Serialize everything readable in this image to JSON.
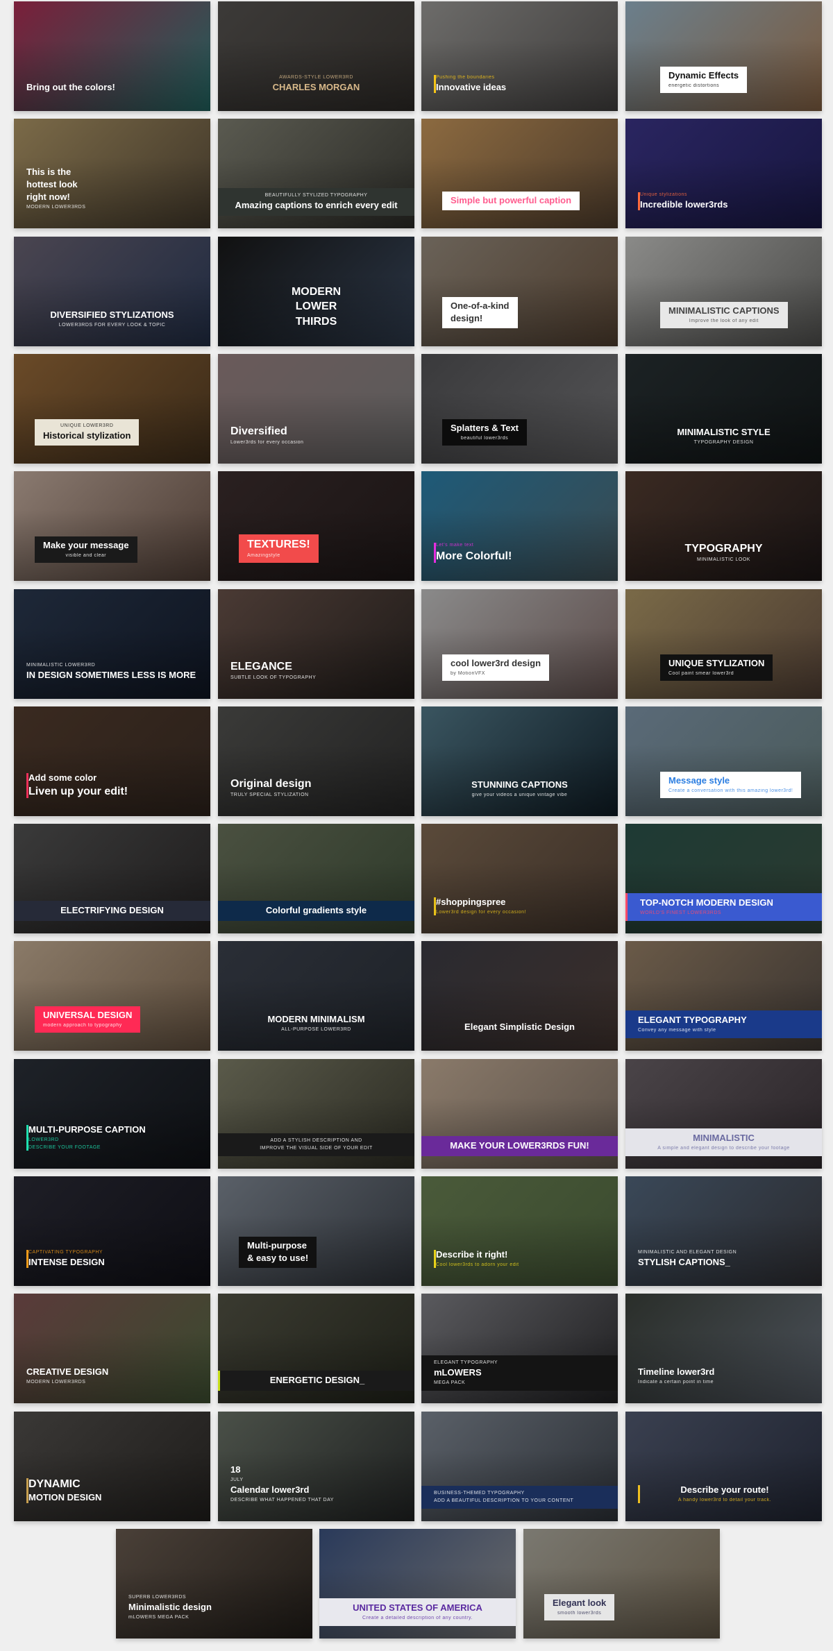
{
  "tiles": [
    {
      "bg": [
        "#7a1f3a",
        "#1f5e5a"
      ],
      "lines": [
        {
          "t": "Bring out the colors!",
          "k": "h"
        }
      ]
    },
    {
      "bg": [
        "#3c3a38",
        "#2a2724"
      ],
      "fg": "#d8b98a",
      "lines": [
        {
          "t": "AWARDS-STYLE LOWER3RD",
          "k": "s"
        },
        {
          "t": "CHARLES MORGAN",
          "k": "h"
        }
      ]
    },
    {
      "bg": [
        "#6d6c6a",
        "#3d3b3a"
      ],
      "accent": "#f5c518",
      "lines": [
        {
          "t": "Pushing the boundaries",
          "k": "s"
        },
        {
          "t": "Innovative ideas",
          "k": "h"
        }
      ]
    },
    {
      "bg": [
        "#6b7f8c",
        "#7a5a3e"
      ],
      "box": "#ffffff",
      "fg": "#111111",
      "lines": [
        {
          "t": "Dynamic Effects",
          "k": "h"
        },
        {
          "t": "energetic distortions",
          "k": "s"
        }
      ]
    },
    {
      "bg": [
        "#7b6a48",
        "#3e3528"
      ],
      "lines": [
        {
          "t": "This is the",
          "k": "h"
        },
        {
          "t": "hottest look",
          "k": "h"
        },
        {
          "t": "right now!",
          "k": "h"
        },
        {
          "t": "MODERN LOWER3RDS",
          "k": "s"
        }
      ]
    },
    {
      "bg": [
        "#5a5a50",
        "#2a2a26"
      ],
      "box": "#2f3430",
      "lines": [
        {
          "t": "BEAUTIFULLY STYLIZED TYPOGRAPHY",
          "k": "s"
        },
        {
          "t": "Amazing captions to enrich every edit",
          "k": "h"
        }
      ]
    },
    {
      "bg": [
        "#8c6a40",
        "#4b3a2a"
      ],
      "box": "#ffffff",
      "fg": "#ff5d8f",
      "lines": [
        {
          "t": "Simple but powerful caption",
          "k": "h"
        }
      ]
    },
    {
      "bg": [
        "#2a2560",
        "#171640"
      ],
      "accent": "#ff6b3d",
      "lines": [
        {
          "t": "Unique stylizations",
          "k": "s"
        },
        {
          "t": "Incredible lower3rds",
          "k": "h"
        }
      ]
    },
    {
      "bg": [
        "#4a4550",
        "#1f2a40"
      ],
      "lines": [
        {
          "t": "DIVERSIFIED STYLIZATIONS",
          "k": "h"
        },
        {
          "t": "LOWER3RDS FOR EVERY LOOK & TOPIC",
          "k": "s"
        }
      ]
    },
    {
      "bg": [
        "#111111",
        "#2a3545"
      ],
      "lines": [
        {
          "t": "MODERN",
          "k": "xl"
        },
        {
          "t": "LOWER",
          "k": "xl"
        },
        {
          "t": "THIRDS",
          "k": "xl"
        }
      ]
    },
    {
      "bg": [
        "#6a6258",
        "#4a3a2c"
      ],
      "box": "#ffffff",
      "fg": "#333333",
      "lines": [
        {
          "t": "One-of-a-kind",
          "k": "h"
        },
        {
          "t": "design!",
          "k": "h"
        }
      ]
    },
    {
      "bg": [
        "#8a8a88",
        "#4a4a48"
      ],
      "box": "#e8e8e8",
      "fg": "#444444",
      "lines": [
        {
          "t": "MINIMALISTIC CAPTIONS",
          "k": "h"
        },
        {
          "t": "Improve the look of any edit",
          "k": "s"
        }
      ]
    },
    {
      "bg": [
        "#6a4a28",
        "#3a2a18"
      ],
      "box": "#e9e4d6",
      "fg": "#111111",
      "lines": [
        {
          "t": "UNIQUE LOWER3RD",
          "k": "s"
        },
        {
          "t": "Historical stylization",
          "k": "h"
        }
      ]
    },
    {
      "bg": [
        "#6a5a5a",
        "#5a5a5a"
      ],
      "lines": [
        {
          "t": "Diversified",
          "k": "xl"
        },
        {
          "t": "Lower3rds for every occasion",
          "k": "s"
        }
      ]
    },
    {
      "bg": [
        "#3a3a3c",
        "#545456"
      ],
      "box": "#0c0c0c",
      "lines": [
        {
          "t": "Splatters & Text",
          "k": "h"
        },
        {
          "t": "beautiful lower3rds",
          "k": "s"
        }
      ]
    },
    {
      "bg": [
        "#1c2224",
        "#0f1314"
      ],
      "lines": [
        {
          "t": "MINIMALISTIC STYLE",
          "k": "h"
        },
        {
          "t": "TYPOGRAPHY DESIGN",
          "k": "s"
        }
      ]
    },
    {
      "bg": [
        "#8a7a70",
        "#4a3a32"
      ],
      "box": "#1a1a1a",
      "lines": [
        {
          "t": "Make your message",
          "k": "h"
        },
        {
          "t": "visible and clear",
          "k": "s"
        }
      ]
    },
    {
      "bg": [
        "#2a2020",
        "#1a1414"
      ],
      "box": "#f24b4b",
      "lines": [
        {
          "t": "TEXTURES!",
          "k": "xl"
        },
        {
          "t": "Amazingstyle",
          "k": "s"
        }
      ]
    },
    {
      "bg": [
        "#1e5a78",
        "#3a4a50"
      ],
      "accent": "#e52ee0",
      "lines": [
        {
          "t": "Let's make text",
          "k": "s"
        },
        {
          "t": "More Colorful!",
          "k": "xl"
        }
      ]
    },
    {
      "bg": [
        "#3a2a22",
        "#1a1414"
      ],
      "lines": [
        {
          "t": "TYPOGRAPHY",
          "k": "xl"
        },
        {
          "t": "MINIMALISTIC LOOK",
          "k": "s"
        }
      ]
    },
    {
      "bg": [
        "#1e2838",
        "#0e1420"
      ],
      "lines": [
        {
          "t": "MINIMALISTIC LOWER3RD",
          "k": "s"
        },
        {
          "t": "IN DESIGN SOMETIMES LESS IS MORE",
          "k": "h"
        }
      ]
    },
    {
      "bg": [
        "#4a3a34",
        "#1e1a18"
      ],
      "lines": [
        {
          "t": "ELEGANCE",
          "k": "xl"
        },
        {
          "t": "SUBTLE LOOK OF TYPOGRAPHY",
          "k": "s"
        }
      ]
    },
    {
      "bg": [
        "#8a8a8a",
        "#5a4a48"
      ],
      "box": "#ffffff",
      "fg": "#333333",
      "lines": [
        {
          "t": "cool lower3rd design",
          "k": "h"
        },
        {
          "t": "by MotionVFX",
          "k": "s"
        }
      ]
    },
    {
      "bg": [
        "#7a6a48",
        "#4a3a30"
      ],
      "box": "#111111",
      "lines": [
        {
          "t": "UNIQUE STYLIZATION",
          "k": "h"
        },
        {
          "t": "Cool paint smear lower3rd",
          "k": "s"
        }
      ]
    },
    {
      "bg": [
        "#3a2a20",
        "#2a201a"
      ],
      "accent": "#f0305a",
      "lines": [
        {
          "t": "Add some color",
          "k": "h"
        },
        {
          "t": "Liven up your edit!",
          "k": "xl"
        }
      ]
    },
    {
      "bg": [
        "#3a3a38",
        "#222222"
      ],
      "lines": [
        {
          "t": "Original design",
          "k": "xl"
        },
        {
          "t": "TRULY SPECIAL STYLIZATION",
          "k": "s"
        }
      ]
    },
    {
      "bg": [
        "#3a5560",
        "#0e1a22"
      ],
      "lines": [
        {
          "t": "STUNNING CAPTIONS",
          "k": "h"
        },
        {
          "t": "give your videos a unique vintage vibe",
          "k": "s"
        }
      ]
    },
    {
      "bg": [
        "#5a6a78",
        "#4a5a5a"
      ],
      "box": "#ffffff",
      "fg": "#2a7de1",
      "lines": [
        {
          "t": "Message style",
          "k": "h"
        },
        {
          "t": "Create a conversation with this amazing lower3rd!",
          "k": "s"
        }
      ]
    },
    {
      "bg": [
        "#3a3a3a",
        "#1e1c1c"
      ],
      "box": "#262a38",
      "lines": [
        {
          "t": "ELECTRIFYING DESIGN",
          "k": "h"
        }
      ]
    },
    {
      "bg": [
        "#4a5040",
        "#2e3a2a"
      ],
      "box": "#0e2a4a",
      "lines": [
        {
          "t": "Colorful gradients style",
          "k": "h"
        }
      ]
    },
    {
      "bg": [
        "#5a4a3a",
        "#3a2e26"
      ],
      "accent": "#e8c21a",
      "lines": [
        {
          "t": "#shoppingspree",
          "k": "h"
        },
        {
          "t": "Lower3rd design for every occasion!",
          "k": "s"
        }
      ]
    },
    {
      "bg": [
        "#1e3a34",
        "#2a3a30"
      ],
      "box": "#3a5ad0",
      "accent": "#ff4a6a",
      "lines": [
        {
          "t": "TOP-NOTCH MODERN DESIGN",
          "k": "h"
        },
        {
          "t": "WORLD'S FINEST LOWER3RDS",
          "k": "s"
        }
      ]
    },
    {
      "bg": [
        "#8a7a68",
        "#5a4a3a"
      ],
      "box": "#ff2a55",
      "lines": [
        {
          "t": "UNIVERSAL DESIGN",
          "k": "h"
        },
        {
          "t": "modern approach to typography",
          "k": "s"
        }
      ]
    },
    {
      "bg": [
        "#2a2e36",
        "#1e2228"
      ],
      "lines": [
        {
          "t": "MODERN MINIMALISM",
          "k": "h"
        },
        {
          "t": "ALL-PURPOSE LOWER3RD",
          "k": "s"
        }
      ]
    },
    {
      "bg": [
        "#2a2a30",
        "#3a2e2a"
      ],
      "lines": [
        {
          "t": "Elegant Simplistic Design",
          "k": "h"
        }
      ]
    },
    {
      "bg": [
        "#6a5a48",
        "#3a3430"
      ],
      "box": "#1a3a8a",
      "lines": [
        {
          "t": "ELEGANT TYPOGRAPHY",
          "k": "h"
        },
        {
          "t": "Convey any message with style",
          "k": "s"
        }
      ]
    },
    {
      "bg": [
        "#1e2228",
        "#0e1014"
      ],
      "accent": "#1ee0b0",
      "lines": [
        {
          "t": "MULTI-PURPOSE CAPTION",
          "k": "h"
        },
        {
          "t": "LOWER3RD",
          "k": "s"
        },
        {
          "t": "DESCRIBE YOUR FOOTAGE",
          "k": "s"
        }
      ]
    },
    {
      "bg": [
        "#5a5a4a",
        "#2a2a22"
      ],
      "box": "#1a1a1a",
      "lines": [
        {
          "t": "ADD A STYLISH DESCRIPTION AND",
          "k": "s"
        },
        {
          "t": "IMPROVE THE VISUAL SIDE OF YOUR EDIT",
          "k": "s"
        }
      ]
    },
    {
      "bg": [
        "#8a7a6a",
        "#5a5048"
      ],
      "box": "#6a2a9a",
      "lines": [
        {
          "t": "MAKE YOUR LOWER3RDS FUN!",
          "k": "h"
        }
      ]
    },
    {
      "bg": [
        "#4a4448",
        "#2a2428"
      ],
      "box": "#e4e4ea",
      "fg": "#6a6aa0",
      "lines": [
        {
          "t": "MINIMALISTIC",
          "k": "h"
        },
        {
          "t": "A simple and elegant design to describe your footage",
          "k": "s"
        }
      ]
    },
    {
      "bg": [
        "#1e1e26",
        "#0e0e14"
      ],
      "accent": "#f09a1a",
      "lines": [
        {
          "t": "CAPTIVATING TYPOGRAPHY",
          "k": "s"
        },
        {
          "t": "INTENSE DESIGN",
          "k": "h"
        }
      ]
    },
    {
      "bg": [
        "#5a6068",
        "#2a2e34"
      ],
      "box": "#111111",
      "lines": [
        {
          "t": "Multi-purpose",
          "k": "h"
        },
        {
          "t": "& easy to use!",
          "k": "h"
        }
      ]
    },
    {
      "bg": [
        "#4a5a3a",
        "#3a4a2e"
      ],
      "accent": "#e8d21a",
      "lines": [
        {
          "t": "Describe it right!",
          "k": "h"
        },
        {
          "t": "Cool lower3rds to adorn your edit",
          "k": "s"
        }
      ]
    },
    {
      "bg": [
        "#3a4858",
        "#2a2a2e"
      ],
      "lines": [
        {
          "t": "MINIMALISTIC AND ELEGANT DESIGN",
          "k": "s"
        },
        {
          "t": "STYLISH CAPTIONS_",
          "k": "h"
        }
      ]
    },
    {
      "bg": [
        "#5a3a3a",
        "#3a4a2e"
      ],
      "lines": [
        {
          "t": "CREATIVE DESIGN",
          "k": "h"
        },
        {
          "t": "MODERN LOWER3RDS",
          "k": "s"
        }
      ]
    },
    {
      "bg": [
        "#3a3a30",
        "#1e2018"
      ],
      "box": "#1a1a1a",
      "accent": "#c8e01a",
      "lines": [
        {
          "t": "ENERGETIC DESIGN_",
          "k": "h"
        }
      ]
    },
    {
      "bg": [
        "#5a5a5e",
        "#1e1e20"
      ],
      "box": "#141414",
      "lines": [
        {
          "t": "ELEGANT TYPOGRAPHY",
          "k": "s"
        },
        {
          "t": "mLOWERS",
          "k": "h"
        },
        {
          "t": "MEGA PACK",
          "k": "s"
        }
      ]
    },
    {
      "bg": [
        "#2a2e2a",
        "#4a5058"
      ],
      "lines": [
        {
          "t": "Timeline lower3rd",
          "k": "h"
        },
        {
          "t": "Indicate a certain point in time",
          "k": "s"
        }
      ]
    },
    {
      "bg": [
        "#3a3836",
        "#1e1c1a"
      ],
      "accent": "#c8a050",
      "lines": [
        {
          "t": "DYNAMIC",
          "k": "xl"
        },
        {
          "t": "MOTION DESIGN",
          "k": "h"
        }
      ]
    },
    {
      "bg": [
        "#4a5048",
        "#1e2020"
      ],
      "lines": [
        {
          "t": "18",
          "k": "h"
        },
        {
          "t": "JULY",
          "k": "s"
        },
        {
          "t": "Calendar lower3rd",
          "k": "h"
        },
        {
          "t": "DESCRIBE WHAT HAPPENED THAT DAY",
          "k": "s"
        }
      ]
    },
    {
      "bg": [
        "#5a6068",
        "#2a2e34"
      ],
      "box": "#1a2e5a",
      "lines": [
        {
          "t": "BUSINESS-THEMED TYPOGRAPHY",
          "k": "s"
        },
        {
          "t": "ADD A BEAUTIFUL DESCRIPTION TO YOUR CONTENT",
          "k": "s"
        }
      ]
    },
    {
      "bg": [
        "#3a4050",
        "#1e222e"
      ],
      "accent": "#f0c020",
      "lines": [
        {
          "t": "Describe your route!",
          "k": "h"
        },
        {
          "t": "A handy lower3rd to detail your track.",
          "k": "s"
        }
      ]
    },
    {
      "bg": [
        "#4a4038",
        "#1e1a16"
      ],
      "lines": [
        {
          "t": "SUPERB LOWER3RDS",
          "k": "s"
        },
        {
          "t": "Minimalistic design",
          "k": "h"
        },
        {
          "t": "mLOWERS MEGA PACK",
          "k": "s"
        }
      ]
    },
    {
      "bg": [
        "#2a3a5a",
        "#6a6a6a"
      ],
      "box": "#e8e8ee",
      "fg": "#5a2aa0",
      "lines": [
        {
          "t": "UNITED STATES OF AMERICA",
          "k": "h"
        },
        {
          "t": "Create a detailed description of any country.",
          "k": "s"
        }
      ]
    },
    {
      "bg": [
        "#7a7870",
        "#5a5040"
      ],
      "box": "#e6e6e6",
      "fg": "#333355",
      "lines": [
        {
          "t": "Elegant look",
          "k": "h"
        },
        {
          "t": "smooth lower3rds",
          "k": "s"
        }
      ]
    }
  ]
}
